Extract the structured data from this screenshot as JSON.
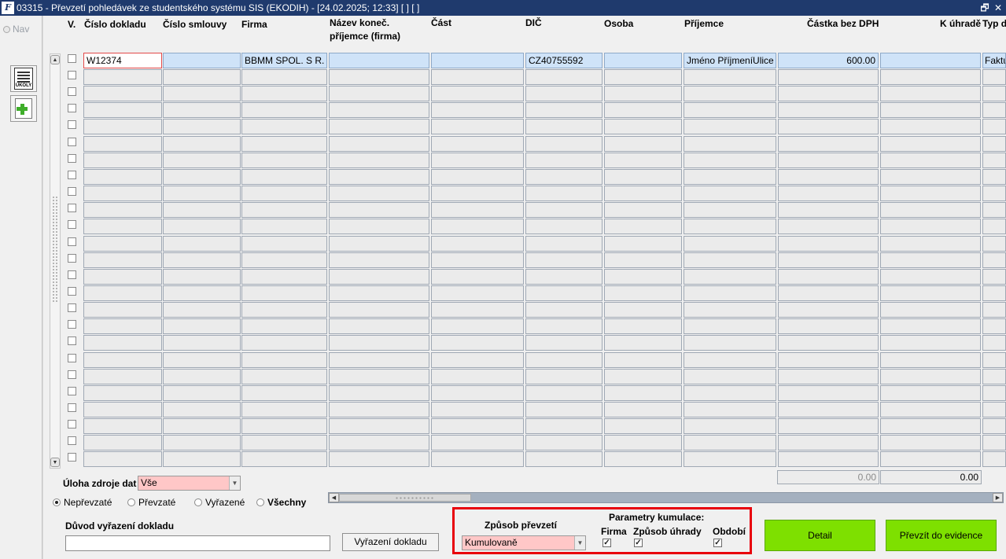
{
  "window": {
    "title": "03315 - Převzetí pohledávek ze studentského systému SIS (EKODIH) - [24.02.2025; 12:33]  [ ]  [ ]",
    "restore_glyph": "🗗",
    "close_glyph": "✕"
  },
  "nav": {
    "label": "Nav"
  },
  "toolbar": {
    "ukoly_label": "ÚKOLY"
  },
  "columns": [
    "V.",
    "Číslo dokladu",
    "Číslo smlouvy",
    "Firma",
    "Název koneč.",
    "příjemce (firma)",
    "Část",
    "DIČ",
    "Osoba",
    "Příjemce",
    "Částka bez DPH",
    "K úhradě",
    "Typ d"
  ],
  "rows": [
    {
      "cislo_dokladu": "W12374",
      "cislo_smlouvy": "",
      "firma": "BBMM SPOL. S R. O.",
      "nazev_prijemce": "",
      "cast": "",
      "dic": "CZ40755592",
      "osoba": "",
      "prijemce": "Jméno PříjmeníUlice",
      "castka_bez_dph": "600.00",
      "k_uhrade": "",
      "typ": "Faktura"
    }
  ],
  "empty_row_count": 24,
  "totals": {
    "castka_bez_dph": "0.00",
    "k_uhrade": "0.00"
  },
  "filters": {
    "uloha_label": "Úloha zdroje dat",
    "uloha_value": "Vše",
    "radios": [
      "Nepřevzaté",
      "Převzaté",
      "Vyřazené",
      "Všechny"
    ],
    "selected_radio": "Nepřevzaté"
  },
  "duvod": {
    "label": "Důvod vyřazení dokladu",
    "value": ""
  },
  "buttons": {
    "vyrazeni": "Vyřazení dokladu",
    "detail": "Detail",
    "prevzit": "Převzít do evidence"
  },
  "zpusob": {
    "label": "Způsob převzetí",
    "value": "Kumulovaně"
  },
  "kumulace": {
    "label": "Parametry kumulace:",
    "firma": "Firma",
    "zpusob_uhrady": "Způsob úhrady",
    "obdobi": "Období",
    "check_glyph": "✓"
  },
  "icons": {
    "scroll_up": "▲",
    "scroll_down": "▼",
    "scroll_left": "◀",
    "scroll_right": "▶",
    "dropdown": "▼"
  },
  "colors": {
    "titlebar": "#1f3a6d",
    "required_field": "#ffc7c7",
    "active_row": "#cfe3f8",
    "green_button": "#7ee000",
    "highlight_border": "#e8000b"
  }
}
